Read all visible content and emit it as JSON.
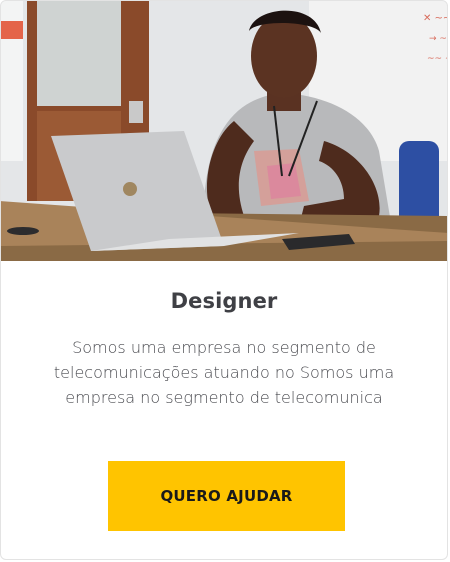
{
  "card": {
    "image_alt": "young man working on laptop at desk",
    "title": "Designer",
    "description": "Somos uma empresa no segmento de telecomunicações atuando no Somos uma empresa no segmento de telecomunica",
    "cta_label": "QUERO AJUDAR"
  },
  "colors": {
    "accent": "#ffc400",
    "title": "#3f4045",
    "text": "#4a4b50",
    "border": "#e3e3e3"
  }
}
